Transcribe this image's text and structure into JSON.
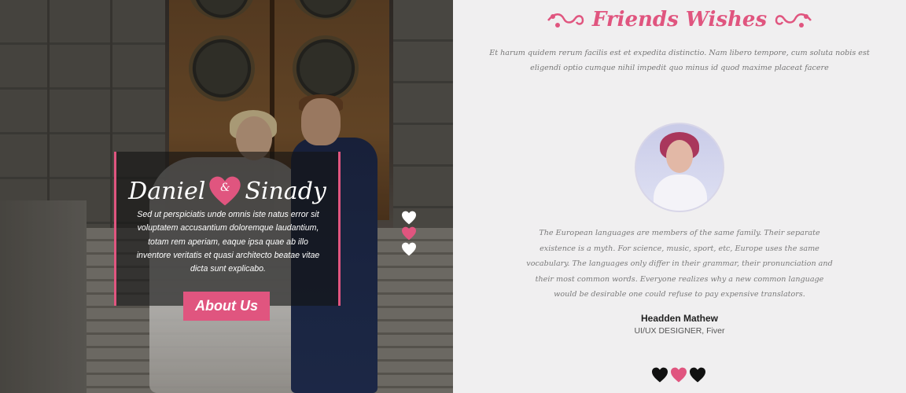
{
  "hero": {
    "name_left": "Daniel",
    "ampersand": "&",
    "name_right": "Sinady",
    "description": "Sed ut perspiciatis unde omnis iste natus error sit voluptatem accusantium doloremque laudantium, totam rem aperiam, eaque ipsa quae ab illo inventore veritatis et quasi architecto beatae vitae dicta sunt explicabo.",
    "button_label": "About Us"
  },
  "slider_dots": [
    {
      "color": "#ffffff",
      "active": false
    },
    {
      "color": "#e0557f",
      "active": true
    },
    {
      "color": "#ffffff",
      "active": false
    }
  ],
  "wishes": {
    "title": "Friends Wishes",
    "intro": "Et harum quidem rerum facilis est et expedita distinctio. Nam libero tempore, cum soluta nobis est eligendi optio cumque nihil impedit quo minus id quod maxime placeat facere",
    "testimonial": {
      "quote": "The European languages are members of the same family. Their separate existence is a myth. For science, music, sport, etc, Europe uses the same vocabulary. The languages only differ in their grammar, their pronunciation and their most common words. Everyone realizes why a new common language would be desirable one could refuse to pay expensive translators.",
      "name": "Headden Mathew",
      "role": "UI/UX DESIGNER, Fiver"
    },
    "pager": [
      {
        "color": "#111111",
        "active": false
      },
      {
        "color": "#e0557f",
        "active": true
      },
      {
        "color": "#111111",
        "active": false
      }
    ]
  },
  "colors": {
    "accent": "#e0557f",
    "background": "#f0eff0",
    "text_muted": "#777777"
  }
}
